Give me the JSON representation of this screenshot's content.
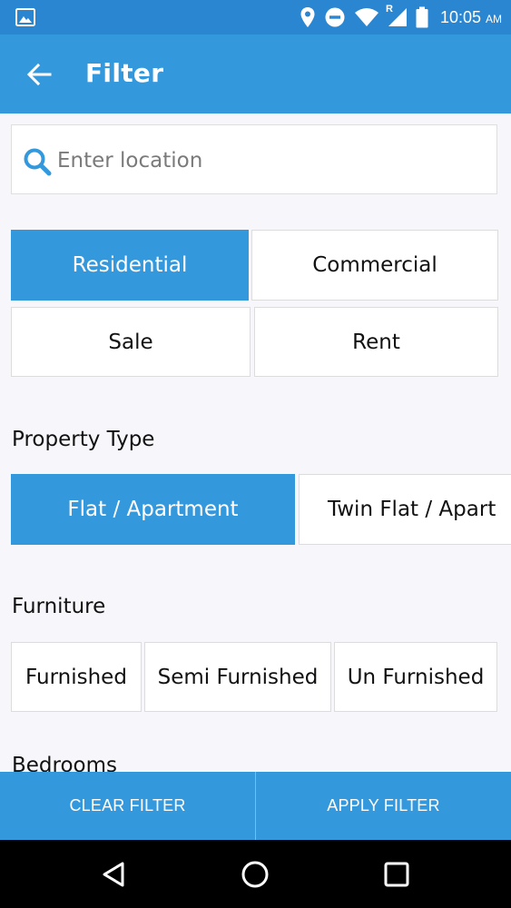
{
  "status_bar": {
    "time": "10:05",
    "ampm": "AM",
    "network_label": "R"
  },
  "app_bar": {
    "title": "Filter"
  },
  "search": {
    "placeholder": "Enter location",
    "value": ""
  },
  "category": {
    "options": [
      "Residential",
      "Commercial"
    ],
    "selected": "Residential"
  },
  "listing_type": {
    "options": [
      "Sale",
      "Rent"
    ],
    "selected": ""
  },
  "property_type": {
    "label": "Property Type",
    "options": [
      "Flat / Apartment",
      "Twin Flat / Apart"
    ],
    "selected": "Flat / Apartment"
  },
  "furniture": {
    "label": "Furniture",
    "options": [
      "Furnished",
      "Semi Furnished",
      "Un Furnished"
    ],
    "selected": ""
  },
  "bedrooms": {
    "label": "Bedrooms"
  },
  "actions": {
    "clear": "CLEAR FILTER",
    "apply": "APPLY FILTER"
  },
  "colors": {
    "primary": "#3498dd",
    "status_bar": "#2b86d1",
    "background": "#f7f6fa"
  },
  "icons": {
    "status": [
      "image-icon",
      "location-icon",
      "do-not-disturb-icon",
      "wifi-icon",
      "cell-signal-icon",
      "battery-icon"
    ],
    "app_bar": "arrow-back-icon",
    "search": "search-icon",
    "nav": [
      "nav-back-icon",
      "nav-home-icon",
      "nav-recents-icon"
    ]
  }
}
